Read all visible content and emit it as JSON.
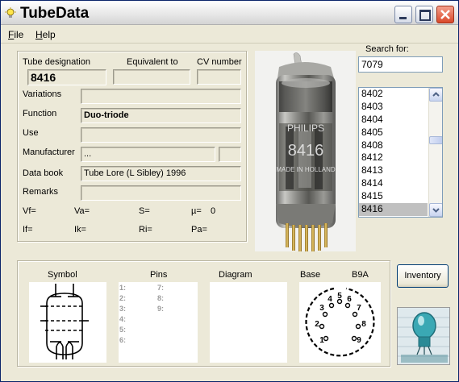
{
  "window": {
    "title": "TubeData"
  },
  "menu": {
    "file": {
      "first": "F",
      "rest": "ile"
    },
    "help": {
      "first": "H",
      "rest": "elp"
    }
  },
  "details": {
    "labels": {
      "designation": "Tube designation",
      "equivalent": "Equivalent to",
      "cv": "CV number",
      "variations": "Variations",
      "function": "Function",
      "use": "Use",
      "manufacturer": "Manufacturer",
      "databook": "Data book",
      "remarks": "Remarks"
    },
    "values": {
      "designation": "8416",
      "equivalent": "",
      "cv": "",
      "variations": "",
      "function": "Duo-triode",
      "use": "",
      "manufacturer": "...",
      "manufacturer_code": "",
      "databook": "Tube Lore (L Sibley) 1996",
      "remarks": ""
    },
    "params": {
      "vf": "Vf=",
      "va": "Va=",
      "s": "S=",
      "mu": "µ=",
      "mu_value": "0",
      "if": "If=",
      "ik": "Ik=",
      "ri": "Ri=",
      "pa": "Pa="
    }
  },
  "search": {
    "label": "Search for:",
    "value": "7079",
    "items": [
      "8402",
      "8403",
      "8404",
      "8405",
      "8408",
      "8412",
      "8413",
      "8414",
      "8415",
      "8416"
    ],
    "selected": "8416"
  },
  "photo": {
    "print_brand": "PHILIPS",
    "print_type": "8416",
    "print_origin": "MADE IN HOLLAND"
  },
  "bottom": {
    "symbol_label": "Symbol",
    "pins_label": "Pins",
    "diagram_label": "Diagram",
    "base_label": "Base",
    "base_type": "B9A",
    "pins_col1": [
      "1:",
      "2:",
      "3:",
      "4:",
      "5:",
      "6:"
    ],
    "pins_col2": [
      "7:",
      "8:",
      "9:"
    ],
    "base_pins": [
      "1",
      "2",
      "3",
      "4",
      "5",
      "6",
      "7",
      "8",
      "9"
    ],
    "inventory_label": "Inventory"
  },
  "colors": {
    "title_bar": "#e6e6e6",
    "close_button": "#d9482a",
    "selection": "#c0c0c0",
    "window_face": "#ece9d8",
    "input_border": "#7f9db9"
  },
  "icons": {
    "app": "lightbulb-icon",
    "minimize": "minimize-icon",
    "maximize": "maximize-icon",
    "close": "close-icon",
    "scroll_up": "chevron-up-icon",
    "scroll_down": "chevron-down-icon"
  }
}
